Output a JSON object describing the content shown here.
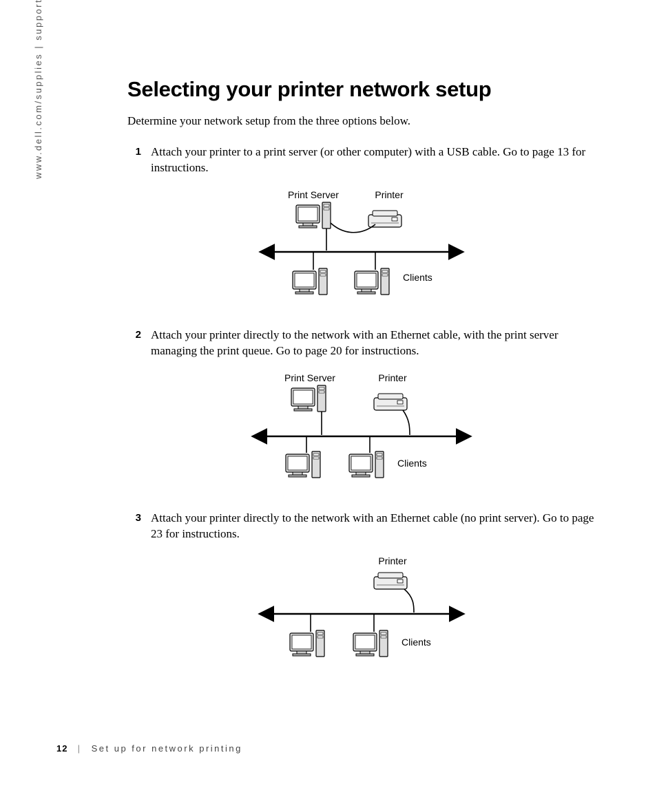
{
  "sidebar": "www.dell.com/supplies | support.dell.com",
  "heading": "Selecting your printer network setup",
  "intro": "Determine your network setup from the three options below.",
  "items": [
    {
      "num": "1",
      "text": "Attach your printer to a print server (or other computer) with a USB cable. Go to page 13 for instructions."
    },
    {
      "num": "2",
      "text": "Attach your printer directly to the network with an Ethernet cable, with the print server managing the print queue. Go to page 20 for instructions."
    },
    {
      "num": "3",
      "text": "Attach your printer directly to the network with an Ethernet cable (no print server). Go to page 23 for instructions."
    }
  ],
  "labels": {
    "print_server": "Print Server",
    "printer": "Printer",
    "clients": "Clients"
  },
  "footer": {
    "page": "12",
    "section": "Set up for network printing"
  }
}
